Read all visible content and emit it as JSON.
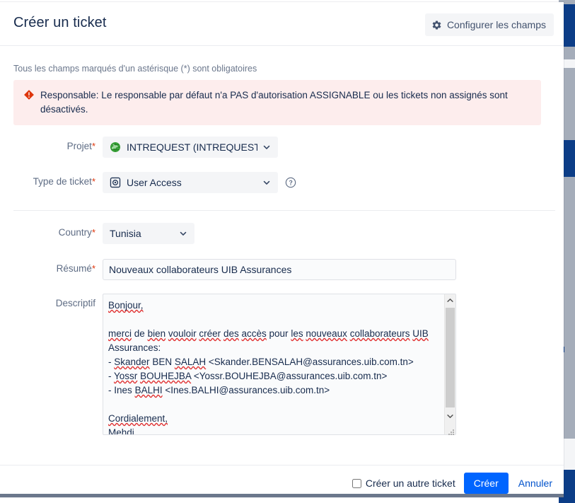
{
  "dialog": {
    "title": "Créer un ticket",
    "configure_fields_label": "Configurer les champs",
    "required_note": "Tous les champs marqués d'un astérisque (*) sont obligatoires"
  },
  "error": {
    "text": "Responsable: Le responsable par défaut n'a PAS d'autorisation ASSIGNABLE ou les tickets non assignés sont désactivés.",
    "icon": "error-diamond-icon",
    "background_color": "#fdeded",
    "icon_color": "#de350b"
  },
  "fields": {
    "project": {
      "label": "Projet",
      "required": "*",
      "value": "INTREQUEST (INTREQUEST)",
      "icon": "globe-icon"
    },
    "issue_type": {
      "label": "Type de ticket",
      "required": "*",
      "value": "User Access",
      "icon": "issue-type-icon",
      "help_icon": "help-circle-icon"
    },
    "country": {
      "label": "Country",
      "required": "*",
      "value": "Tunisia"
    },
    "summary": {
      "label": "Résumé",
      "required": "*",
      "value": "Nouveaux collaborateurs UIB Assurances",
      "placeholder": ""
    },
    "description": {
      "label": "Descriptif",
      "lines": [
        "Bonjour,",
        "",
        "merci de bien vouloir créer des accès pour les nouveaux collaborateurs UIB Assurances:",
        "- Skander BEN SALAH <Skander.BENSALAH@assurances.uib.com.tn>",
        "- Yossr BOUHEJBA <Yossr.BOUHEJBA@assurances.uib.com.tn>",
        "- Ines BALHI <Ines.BALHI@assurances.uib.com.tn>",
        "",
        "Cordialement,",
        "Mehdi"
      ],
      "placeholder": ""
    }
  },
  "footer": {
    "create_another_label": "Créer un autre ticket",
    "create_another_checked": false,
    "create_label": "Créer",
    "cancel_label": "Annuler",
    "primary_color": "#0065ff",
    "link_color": "#0052cc"
  }
}
